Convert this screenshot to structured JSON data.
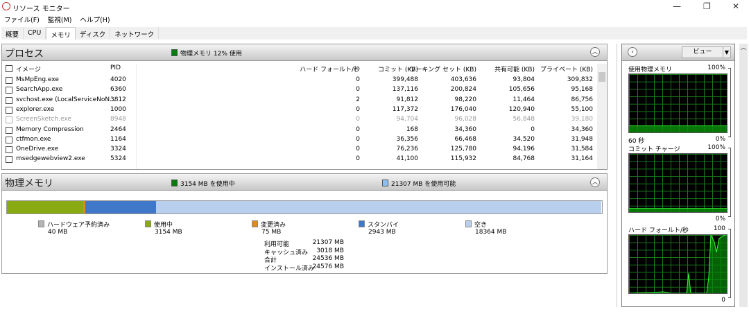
{
  "window": {
    "title": "リソース モニター",
    "icon": "resource-monitor-icon"
  },
  "menu": [
    "ファイル(F)",
    "監視(M)",
    "ヘルプ(H)"
  ],
  "tabs": [
    {
      "label": "概要"
    },
    {
      "label": "CPU"
    },
    {
      "label": "メモリ",
      "active": true
    },
    {
      "label": "ディスク"
    },
    {
      "label": "ネットワーク"
    }
  ],
  "processes": {
    "title": "プロセス",
    "status": "物理メモリ 12% 使用",
    "status_color": "#0a7a0a",
    "columns": [
      "イメージ",
      "PID",
      "ハード フォールト/秒",
      "コミット (KB)",
      "ワーキング セット (KB)",
      "共有可能 (KB)",
      "プライベート (KB)"
    ],
    "rows": [
      [
        "MsMpEng.exe",
        "4020",
        "0",
        "399,488",
        "403,636",
        "93,804",
        "309,832"
      ],
      [
        "SearchApp.exe",
        "6360",
        "0",
        "137,116",
        "200,824",
        "105,656",
        "95,168"
      ],
      [
        "svchost.exe (LocalServiceNoN...",
        "3812",
        "2",
        "91,812",
        "98,220",
        "11,464",
        "86,756"
      ],
      [
        "explorer.exe",
        "1000",
        "0",
        "117,372",
        "176,040",
        "120,940",
        "55,100"
      ],
      [
        "ScreenSketch.exe",
        "8948",
        "0",
        "94,704",
        "96,028",
        "56,848",
        "39,180"
      ],
      [
        "Memory Compression",
        "2464",
        "0",
        "168",
        "34,360",
        "0",
        "34,360"
      ],
      [
        "ctfmon.exe",
        "1164",
        "0",
        "36,356",
        "66,468",
        "34,520",
        "31,948"
      ],
      [
        "OneDrive.exe",
        "3324",
        "0",
        "76,236",
        "125,780",
        "94,196",
        "31,584"
      ],
      [
        "msedgewebview2.exe",
        "5324",
        "0",
        "41,100",
        "115,932",
        "84,768",
        "31,164"
      ]
    ],
    "dimmed_row": 4
  },
  "physical": {
    "title": "物理メモリ",
    "in_use_label": "3154 MB を使用中",
    "available_label": "21307 MB を使用可能",
    "bar": [
      {
        "name": "ハードウェア予約済み",
        "value": "40 MB",
        "mb": 40,
        "color": "#b4b4b4"
      },
      {
        "name": "使用中",
        "value": "3154 MB",
        "mb": 3154,
        "color": "#8aaa14"
      },
      {
        "name": "変更済み",
        "value": "75 MB",
        "mb": 75,
        "color": "#e08a1e"
      },
      {
        "name": "スタンバイ",
        "value": "2943 MB",
        "mb": 2943,
        "color": "#3f78c8"
      },
      {
        "name": "空き",
        "value": "18364 MB",
        "mb": 18364,
        "color": "#b8d0ee"
      }
    ],
    "summary": [
      {
        "label": "利用可能",
        "value": "21307 MB"
      },
      {
        "label": "キャッシュ済み",
        "value": "3018 MB"
      },
      {
        "label": "合計",
        "value": "24536 MB"
      },
      {
        "label": "インストール済み",
        "value": "24576 MB"
      }
    ]
  },
  "side": {
    "view_label": "ビュー",
    "graphs": [
      {
        "title": "使用物理メモリ",
        "max": "100%",
        "min": "0%",
        "time": "60 秒",
        "level_percent": 12
      },
      {
        "title": "コミット チャージ",
        "max": "100%",
        "min": "0%",
        "level_percent": 7
      },
      {
        "title": "ハード フォールト/秒",
        "max": "100",
        "min": "0"
      }
    ]
  }
}
